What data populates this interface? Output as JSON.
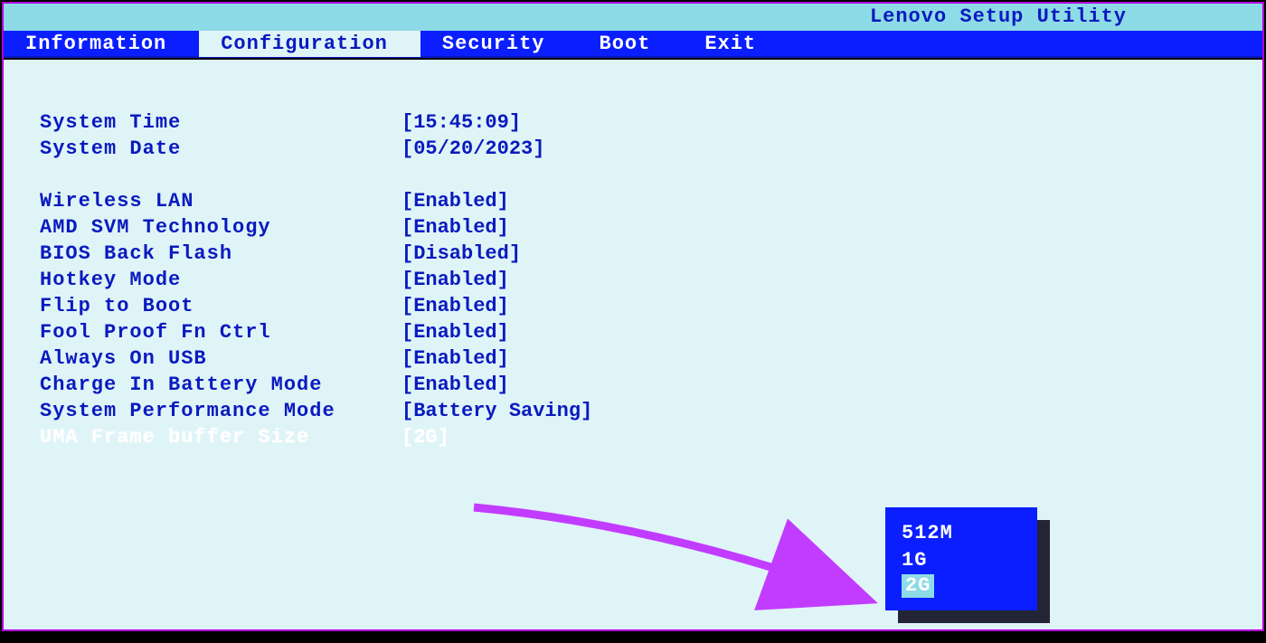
{
  "title": "Lenovo Setup Utility",
  "tabs": [
    {
      "label": "Information",
      "active": false
    },
    {
      "label": "Configuration",
      "active": true
    },
    {
      "label": "Security",
      "active": false
    },
    {
      "label": "Boot",
      "active": false
    },
    {
      "label": "Exit",
      "active": false
    }
  ],
  "settings": [
    {
      "label": "System Time",
      "value": "[15:45:09]",
      "selected": false
    },
    {
      "label": "System Date",
      "value": "[05/20/2023]",
      "selected": false
    },
    {
      "spacer": true
    },
    {
      "label": "Wireless LAN",
      "value": "[Enabled]",
      "selected": false
    },
    {
      "label": "AMD SVM Technology",
      "value": "[Enabled]",
      "selected": false
    },
    {
      "label": "BIOS Back Flash",
      "value": "[Disabled]",
      "selected": false
    },
    {
      "label": "Hotkey Mode",
      "value": "[Enabled]",
      "selected": false
    },
    {
      "label": "Flip to Boot",
      "value": "[Enabled]",
      "selected": false
    },
    {
      "label": "Fool Proof Fn Ctrl",
      "value": "[Enabled]",
      "selected": false
    },
    {
      "label": "Always On USB",
      "value": "[Enabled]",
      "selected": false
    },
    {
      "label": "Charge In Battery Mode",
      "value": "[Enabled]",
      "selected": false
    },
    {
      "label": "System Performance Mode",
      "value": "[Battery Saving]",
      "selected": false
    },
    {
      "label": "UMA Frame buffer Size",
      "value": "[2G]",
      "selected": true
    }
  ],
  "popup": {
    "options": [
      {
        "label": "512M",
        "selected": false
      },
      {
        "label": "1G",
        "selected": false
      },
      {
        "label": "2G",
        "selected": true
      }
    ]
  },
  "annotation_color": "#c23cff"
}
